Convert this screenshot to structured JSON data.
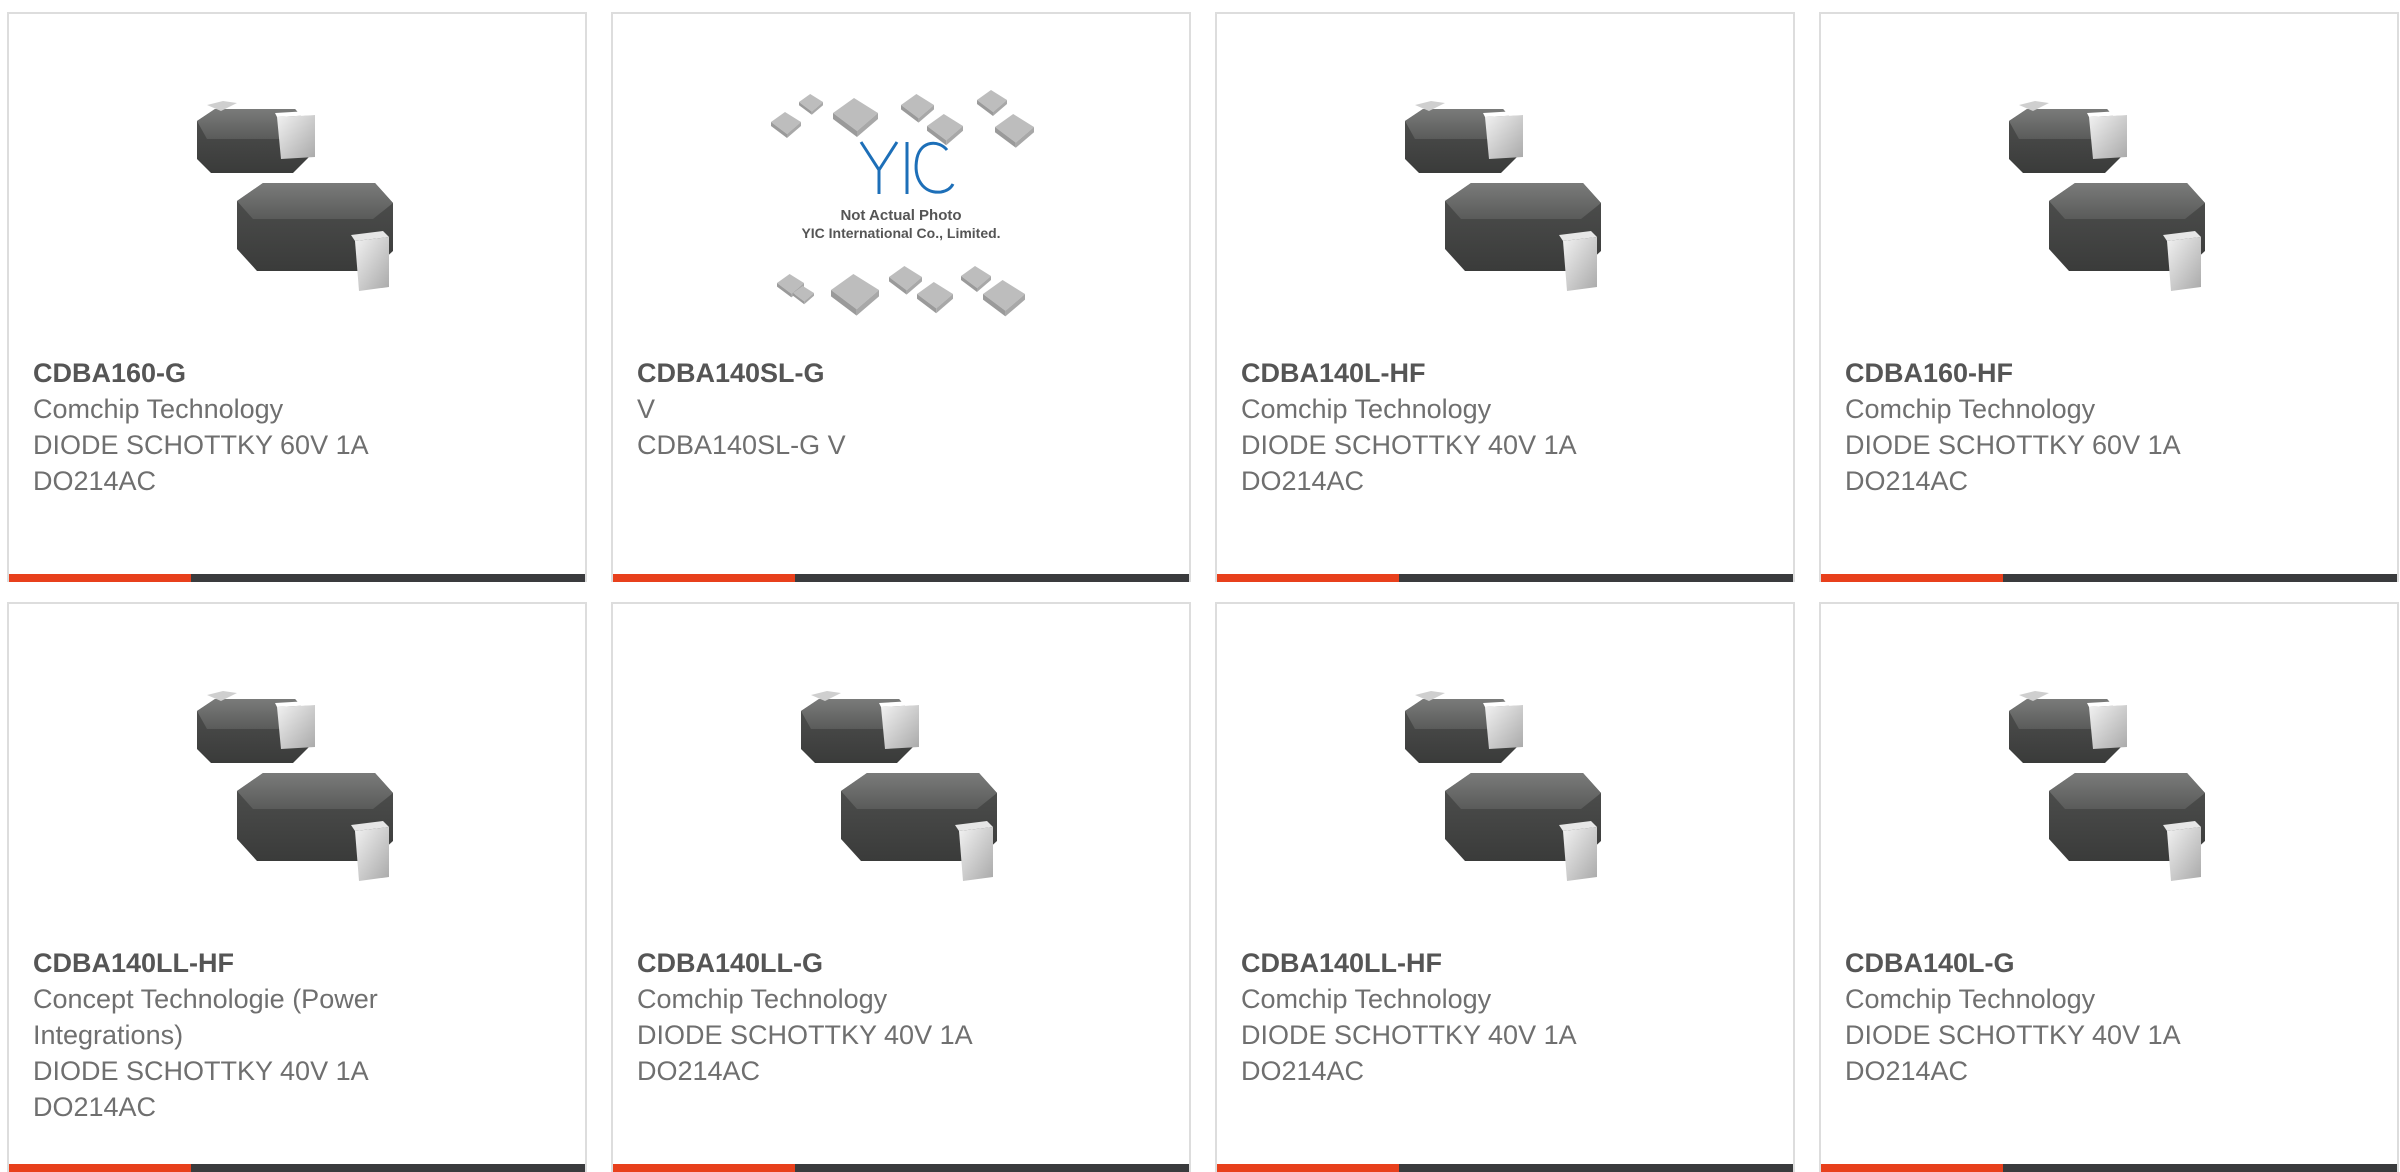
{
  "colors": {
    "accent": "#e8401c",
    "bar": "#3a3b3d",
    "border": "#dddddd",
    "text": "#6f6f6f",
    "part_number": "#555555"
  },
  "products": [
    {
      "part_number": "CDBA160-G",
      "manufacturer": "Comchip Technology",
      "description": "DIODE SCHOTTKY 60V 1A",
      "package": "DO214AC",
      "image": "smd-diode-do214ac-icon"
    },
    {
      "part_number": "CDBA140SL-G",
      "manufacturer": "V",
      "description": "CDBA140SL-G V",
      "package": "",
      "image": "not-actual-photo-icon",
      "placeholder": {
        "logo": "YIC",
        "caption_line1": "Not Actual Photo",
        "caption_line2": "YIC International Co., Limited."
      }
    },
    {
      "part_number": "CDBA140L-HF",
      "manufacturer": "Comchip Technology",
      "description": "DIODE SCHOTTKY 40V 1A",
      "package": "DO214AC",
      "image": "smd-diode-do214ac-icon"
    },
    {
      "part_number": "CDBA160-HF",
      "manufacturer": "Comchip Technology",
      "description": "DIODE SCHOTTKY 60V 1A",
      "package": "DO214AC",
      "image": "smd-diode-do214ac-icon"
    },
    {
      "part_number": "CDBA140LL-HF",
      "manufacturer": "Concept Technologie (Power Integrations)",
      "description": "DIODE SCHOTTKY 40V 1A",
      "package": "DO214AC",
      "image": "smd-diode-do214ac-icon"
    },
    {
      "part_number": "CDBA140LL-G",
      "manufacturer": "Comchip Technology",
      "description": "DIODE SCHOTTKY 40V 1A",
      "package": "DO214AC",
      "image": "smd-diode-do214ac-icon"
    },
    {
      "part_number": "CDBA140LL-HF",
      "manufacturer": "Comchip Technology",
      "description": "DIODE SCHOTTKY 40V 1A",
      "package": "DO214AC",
      "image": "smd-diode-do214ac-icon"
    },
    {
      "part_number": "CDBA140L-G",
      "manufacturer": "Comchip Technology",
      "description": "DIODE SCHOTTKY 40V 1A",
      "package": "DO214AC",
      "image": "smd-diode-do214ac-icon"
    }
  ]
}
